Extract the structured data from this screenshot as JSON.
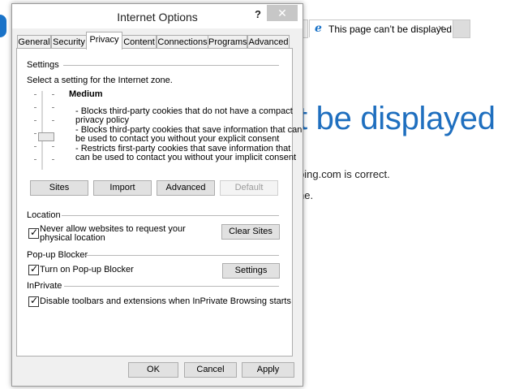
{
  "browser": {
    "tab_title": "This page can’t be displayed",
    "tab_close": "×",
    "headline": "t be displayed",
    "line1": "bing.com is correct.",
    "line2": "ne."
  },
  "dialog": {
    "title": "Internet Options",
    "help_glyph": "?",
    "close_glyph": "✕",
    "tabs": [
      "General",
      "Security",
      "Privacy",
      "Content",
      "Connections",
      "Programs",
      "Advanced"
    ],
    "selected_tab": "Privacy",
    "settings": {
      "group_label": "Settings",
      "instruction": "Select a setting for the Internet zone.",
      "level": "Medium",
      "descriptions": [
        "- Blocks third-party cookies that do not have a compact",
        "privacy policy",
        "- Blocks third-party cookies that save information that can",
        "be used to contact you without your explicit consent",
        "- Restricts first-party cookies that save information that",
        "can be used to contact you without your implicit consent"
      ],
      "buttons": {
        "sites": "Sites",
        "import": "Import",
        "advanced": "Advanced",
        "default": "Default"
      }
    },
    "location": {
      "group_label": "Location",
      "checkbox_label_1": "Never allow websites to request your",
      "checkbox_label_2": "physical location",
      "checked": true,
      "clear_sites": "Clear Sites"
    },
    "popup": {
      "group_label": "Pop-up Blocker",
      "checkbox_label": "Turn on Pop-up Blocker",
      "checked": true,
      "settings_button": "Settings"
    },
    "inprivate": {
      "group_label": "InPrivate",
      "checkbox_label": "Disable toolbars and extensions when InPrivate Browsing starts",
      "checked": true
    },
    "footer": {
      "ok": "OK",
      "cancel": "Cancel",
      "apply": "Apply"
    }
  },
  "colors": {
    "accent": "#1f6fbf",
    "dialog_bg": "#f0f0f0",
    "button_bg": "#e1e1e1"
  },
  "icons": {
    "browser_tab": "ie-logo-icon",
    "checkbox_mark": "checkmark-icon"
  }
}
